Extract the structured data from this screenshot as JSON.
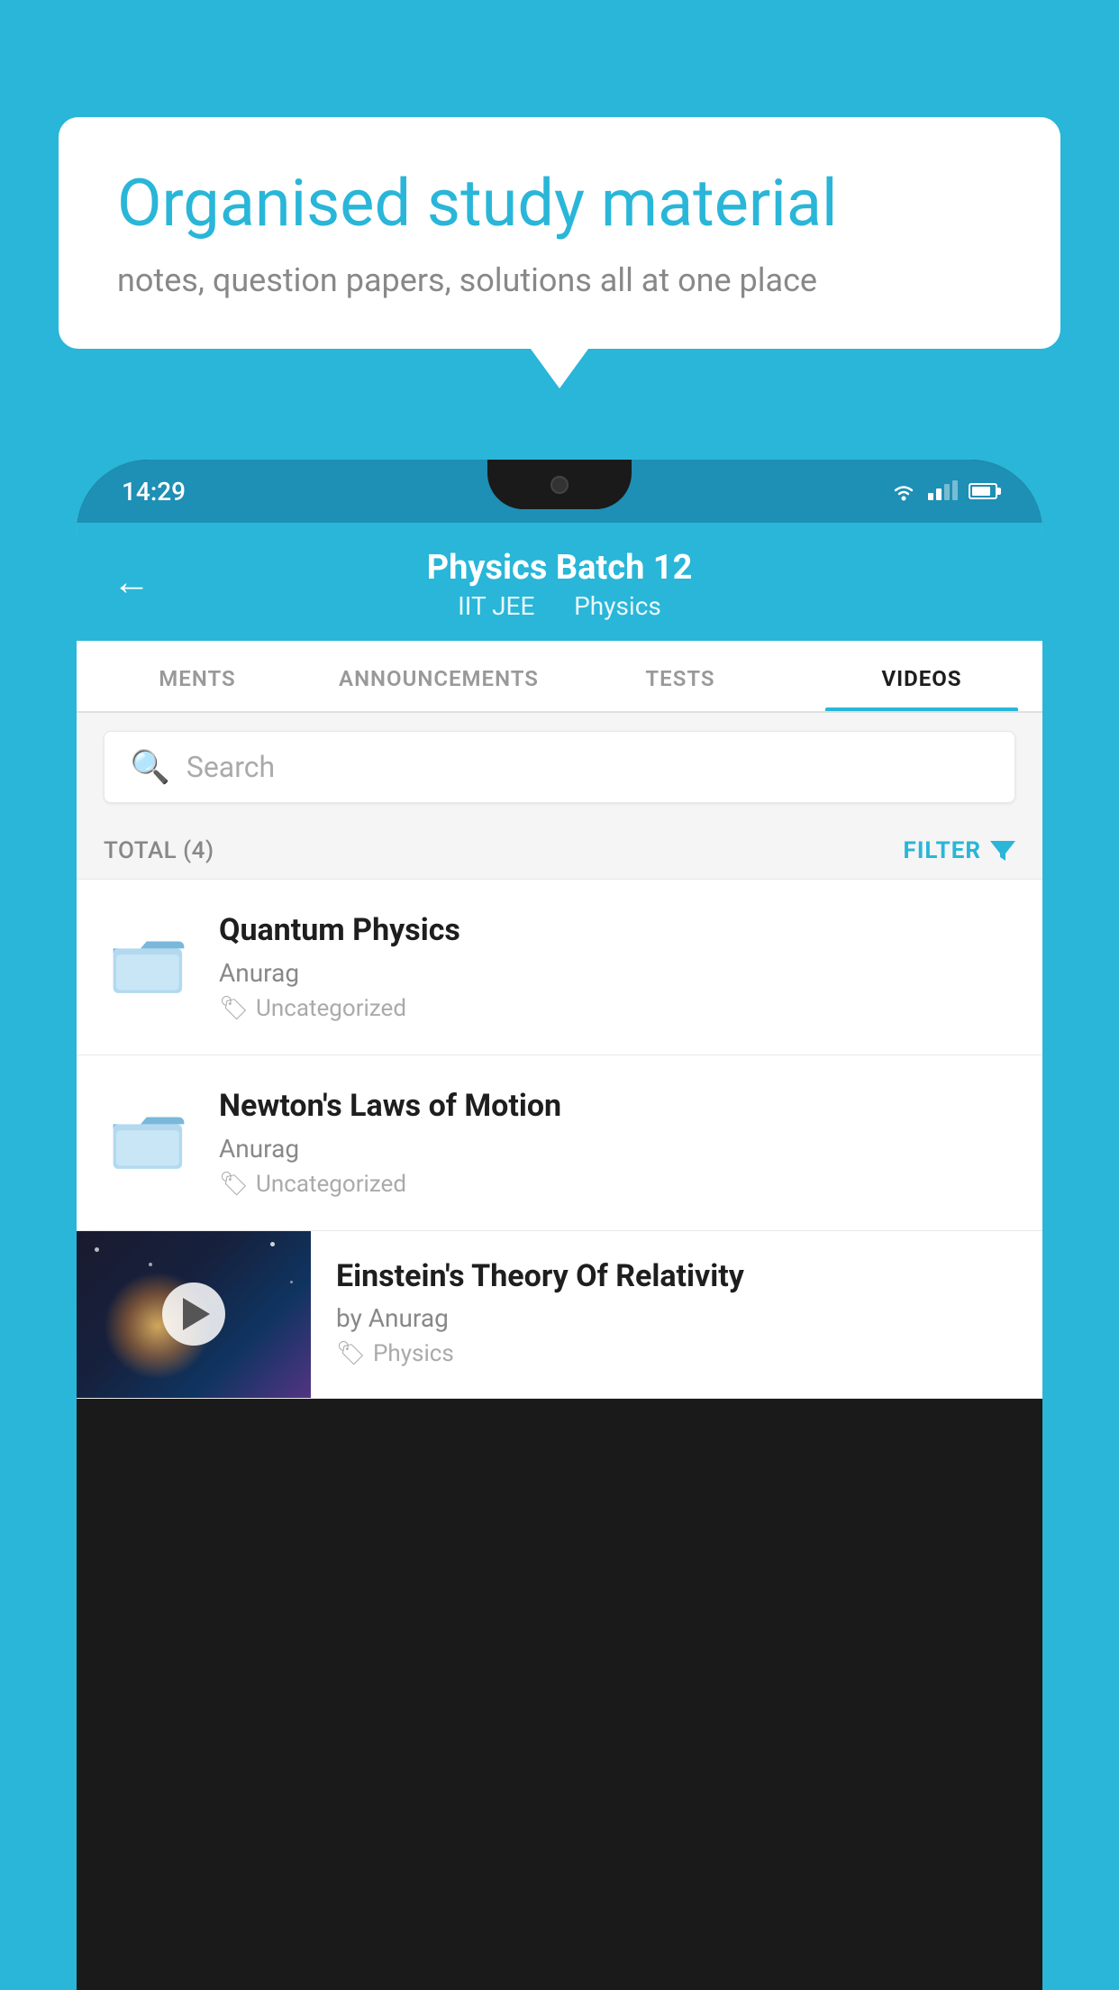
{
  "background": {
    "color": "#29b6d8"
  },
  "speech_bubble": {
    "title": "Organised study material",
    "subtitle": "notes, question papers, solutions all at one place"
  },
  "phone": {
    "status_bar": {
      "time": "14:29"
    },
    "app_header": {
      "title": "Physics Batch 12",
      "subtitle1": "IIT JEE",
      "subtitle2": "Physics"
    },
    "tabs": [
      {
        "label": "MENTS",
        "active": false
      },
      {
        "label": "ANNOUNCEMENTS",
        "active": false
      },
      {
        "label": "TESTS",
        "active": false
      },
      {
        "label": "VIDEOS",
        "active": true
      }
    ],
    "search": {
      "placeholder": "Search"
    },
    "filter": {
      "total_label": "TOTAL (4)",
      "filter_label": "FILTER"
    },
    "videos": [
      {
        "id": 1,
        "title": "Quantum Physics",
        "author": "Anurag",
        "tag": "Uncategorized",
        "type": "folder"
      },
      {
        "id": 2,
        "title": "Newton's Laws of Motion",
        "author": "Anurag",
        "tag": "Uncategorized",
        "type": "folder"
      },
      {
        "id": 3,
        "title": "Einstein's Theory Of Relativity",
        "author": "by Anurag",
        "tag": "Physics",
        "type": "video"
      }
    ]
  }
}
